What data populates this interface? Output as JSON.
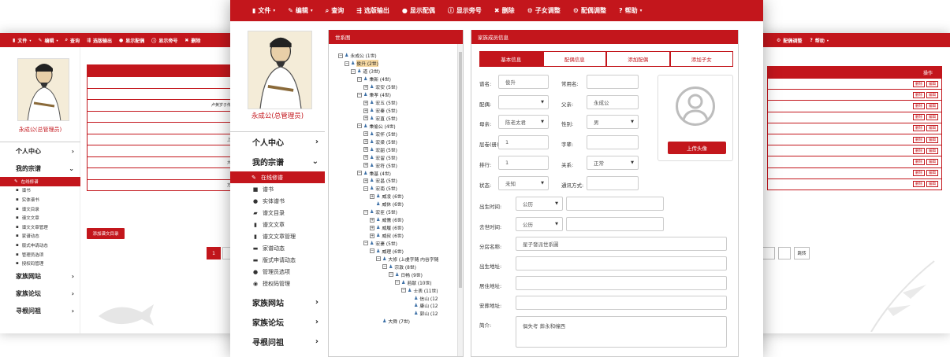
{
  "brand_color": "#c3161c",
  "left_window": {
    "nav": [
      {
        "icon": "file-icon",
        "label": "文件",
        "caret": true
      },
      {
        "icon": "edit-icon",
        "label": "编辑",
        "caret": true
      },
      {
        "icon": "search-icon",
        "label": "查询",
        "caret": false
      },
      {
        "icon": "export-icon",
        "label": "选版输出",
        "caret": false
      },
      {
        "icon": "user-icon",
        "label": "显示配偶",
        "caret": false
      },
      {
        "icon": "info-icon",
        "label": "显示旁号",
        "caret": false
      },
      {
        "icon": "close-icon",
        "label": "删除",
        "caret": false
      }
    ],
    "user_name": "永成公(总管理员)",
    "menu": {
      "personal": "个人中心",
      "my_genealogy": "我的宗谱",
      "items": [
        "在线修谱",
        "谱书",
        "实体谱书",
        "谱文目录",
        "谱文文章",
        "谱文文章管理",
        "家谱动态",
        "版式申请动态",
        "管理员选项",
        "授权码管理"
      ],
      "family_site": "家族网站",
      "family_forum": "家族论坛",
      "roots": "寻根问祖"
    },
    "rows": [
      "",
      "",
      "卢黄岁子传",
      "",
      "",
      "上",
      "",
      "大",
      "",
      "方"
    ],
    "add_button": "添加谱文目录",
    "page": "1"
  },
  "right_window": {
    "nav": [
      {
        "icon": "gear-icon",
        "label": "配偶调整",
        "caret": false
      },
      {
        "icon": "question-icon",
        "label": "帮助",
        "caret": true
      }
    ],
    "header_op": "操作",
    "row_count": 10,
    "btn_delete": "删除",
    "btn_edit": "编辑",
    "next_label": "跳转"
  },
  "center_window": {
    "nav": [
      {
        "icon": "file-icon",
        "label": "文件",
        "caret": true
      },
      {
        "icon": "edit-icon",
        "label": "编辑",
        "caret": true
      },
      {
        "icon": "search-icon",
        "label": "查询",
        "caret": false
      },
      {
        "icon": "export-icon",
        "label": "选版输出",
        "caret": false
      },
      {
        "icon": "user-icon",
        "label": "显示配偶",
        "caret": false
      },
      {
        "icon": "info-icon",
        "label": "显示旁号",
        "caret": false
      },
      {
        "icon": "close-icon",
        "label": "删除",
        "caret": false
      },
      {
        "icon": "gear-icon",
        "label": "子女调整",
        "caret": false
      },
      {
        "icon": "gear-icon",
        "label": "配偶调整",
        "caret": false
      },
      {
        "icon": "question-icon",
        "label": "帮助",
        "caret": true
      }
    ],
    "user_name": "永成公(总管理员)",
    "menu": {
      "personal": "个人中心",
      "my_genealogy": "我的宗谱",
      "items": [
        {
          "icon": "pencil-icon",
          "label": "在线修谱"
        },
        {
          "icon": "book-icon",
          "label": "谱书"
        },
        {
          "icon": "user-icon",
          "label": "实体谱书"
        },
        {
          "icon": "folder-icon",
          "label": "谱文目录"
        },
        {
          "icon": "file-icon",
          "label": "谱文文章"
        },
        {
          "icon": "file-icon",
          "label": "谱文文章管理"
        },
        {
          "icon": "comment-icon",
          "label": "家谱动态"
        },
        {
          "icon": "comment-icon",
          "label": "版式申请动态"
        },
        {
          "icon": "user-icon",
          "label": "管理员选项"
        },
        {
          "icon": "eye-icon",
          "label": "授权码管理"
        }
      ],
      "family_site": "家族网站",
      "family_forum": "家族论坛",
      "roots": "寻根问祖"
    },
    "tree_title": "世系图",
    "tree": [
      {
        "indent": 0,
        "toggle": "⊟",
        "label": "永成公 (1世)",
        "sel": false
      },
      {
        "indent": 1,
        "toggle": "⊟",
        "label": "俊升 (2世)",
        "sel": true
      },
      {
        "indent": 2,
        "toggle": "⊟",
        "label": "道 (3世)",
        "sel": false
      },
      {
        "indent": 3,
        "toggle": "⊟",
        "label": "秉新 (4世)",
        "sel": false
      },
      {
        "indent": 4,
        "toggle": "⊞",
        "label": "宏安 (5世)",
        "sel": false
      },
      {
        "indent": 3,
        "toggle": "⊟",
        "label": "秉孝 (4世)",
        "sel": false
      },
      {
        "indent": 4,
        "toggle": "⊞",
        "label": "宏五 (5世)",
        "sel": false
      },
      {
        "indent": 4,
        "toggle": "⊞",
        "label": "宏秦 (5世)",
        "sel": false
      },
      {
        "indent": 4,
        "toggle": "⊞",
        "label": "宏直 (5世)",
        "sel": false
      },
      {
        "indent": 3,
        "toggle": "⊟",
        "label": "秉偷公 (4世)",
        "sel": false
      },
      {
        "indent": 4,
        "toggle": "⊞",
        "label": "宏怀 (5世)",
        "sel": false
      },
      {
        "indent": 4,
        "toggle": "⊞",
        "label": "宏梁 (5世)",
        "sel": false
      },
      {
        "indent": 4,
        "toggle": "⊞",
        "label": "宏韶 (5世)",
        "sel": false
      },
      {
        "indent": 4,
        "toggle": "⊞",
        "label": "宏留 (5世)",
        "sel": false
      },
      {
        "indent": 4,
        "toggle": "⊞",
        "label": "宏符 (5世)",
        "sel": false
      },
      {
        "indent": 3,
        "toggle": "⊟",
        "label": "秉基 (4世)",
        "sel": false
      },
      {
        "indent": 4,
        "toggle": "⊞",
        "label": "宏昌 (5世)",
        "sel": false
      },
      {
        "indent": 4,
        "toggle": "⊟",
        "label": "宏南 (5世)",
        "sel": false
      },
      {
        "indent": 5,
        "toggle": "⊞",
        "label": "威凌 (6世)",
        "sel": false
      },
      {
        "indent": 5,
        "toggle": "",
        "label": "威休 (6世)",
        "sel": false
      },
      {
        "indent": 4,
        "toggle": "⊟",
        "label": "宏臣 (5世)",
        "sel": false
      },
      {
        "indent": 5,
        "toggle": "⊞",
        "label": "威儒 (6世)",
        "sel": false
      },
      {
        "indent": 5,
        "toggle": "⊞",
        "label": "威履 (6世)",
        "sel": false
      },
      {
        "indent": 5,
        "toggle": "⊞",
        "label": "威叔 (6世)",
        "sel": false
      },
      {
        "indent": 4,
        "toggle": "⊟",
        "label": "宏妻 (5世)",
        "sel": false
      },
      {
        "indent": 5,
        "toggle": "⊟",
        "label": "威理 (6世)",
        "sel": false
      },
      {
        "indent": 6,
        "toggle": "⊟",
        "label": "大修 (上虔字随 内谷字随",
        "sel": false
      },
      {
        "indent": 7,
        "toggle": "⊟",
        "label": "宗敦 (8世)",
        "sel": false
      },
      {
        "indent": 8,
        "toggle": "⊟",
        "label": "日畅 (9世)",
        "sel": false
      },
      {
        "indent": 9,
        "toggle": "⊟",
        "label": "若献 (10世)",
        "sel": false
      },
      {
        "indent": 10,
        "toggle": "⊟",
        "label": "士表 (11世)",
        "sel": false
      },
      {
        "indent": 11,
        "toggle": "",
        "label": "信山 (12",
        "sel": false
      },
      {
        "indent": 11,
        "toggle": "",
        "label": "康山 (12",
        "sel": false
      },
      {
        "indent": 11,
        "toggle": "",
        "label": "郭山 (12",
        "sel": false
      },
      {
        "indent": 6,
        "toggle": "",
        "label": "大舜 (7世)",
        "sel": false
      }
    ],
    "form_title": "家族成员信息",
    "tabs": [
      "基本信息",
      "配偶信息",
      "添加配偶",
      "添加子女"
    ],
    "form": {
      "name_label": "谱名:",
      "name_value": "俊升",
      "common_name_label": "常用名:",
      "common_name_value": "",
      "spouse_label": "配偶:",
      "spouse_value": "",
      "father_label": "父亲:",
      "father_value": "永成公",
      "mother_label": "母亲:",
      "mother_value": "陈老太君",
      "gender_label": "性别:",
      "gender_value": "男",
      "rank_label": "层卷(册):",
      "rank_value": "1",
      "courtesy_label": "字辈:",
      "courtesy_value": "",
      "order_label": "排行:",
      "order_value": "1",
      "relation_label": "关系:",
      "relation_value": "正常",
      "status_label": "状态:",
      "status_value": "未知",
      "contact_label": "通讯方式:",
      "contact_value": "",
      "birth_label": "出生时间:",
      "birth_cal": "公历",
      "birth_value": "",
      "death_label": "去世时间:",
      "death_cal": "公历",
      "death_value": "",
      "branch_label": "分房名称:",
      "branch_value": "星子發派世系圖",
      "birthplace_label": "出生地址:",
      "birthplace_value": "",
      "residence_label": "居住地址:",
      "residence_value": "",
      "burial_label": "安葬地址:",
      "burial_value": "",
      "intro_label": "简介:",
      "intro_value": "俱失考 葬永和幢西",
      "upload_label": "上传头像"
    }
  }
}
